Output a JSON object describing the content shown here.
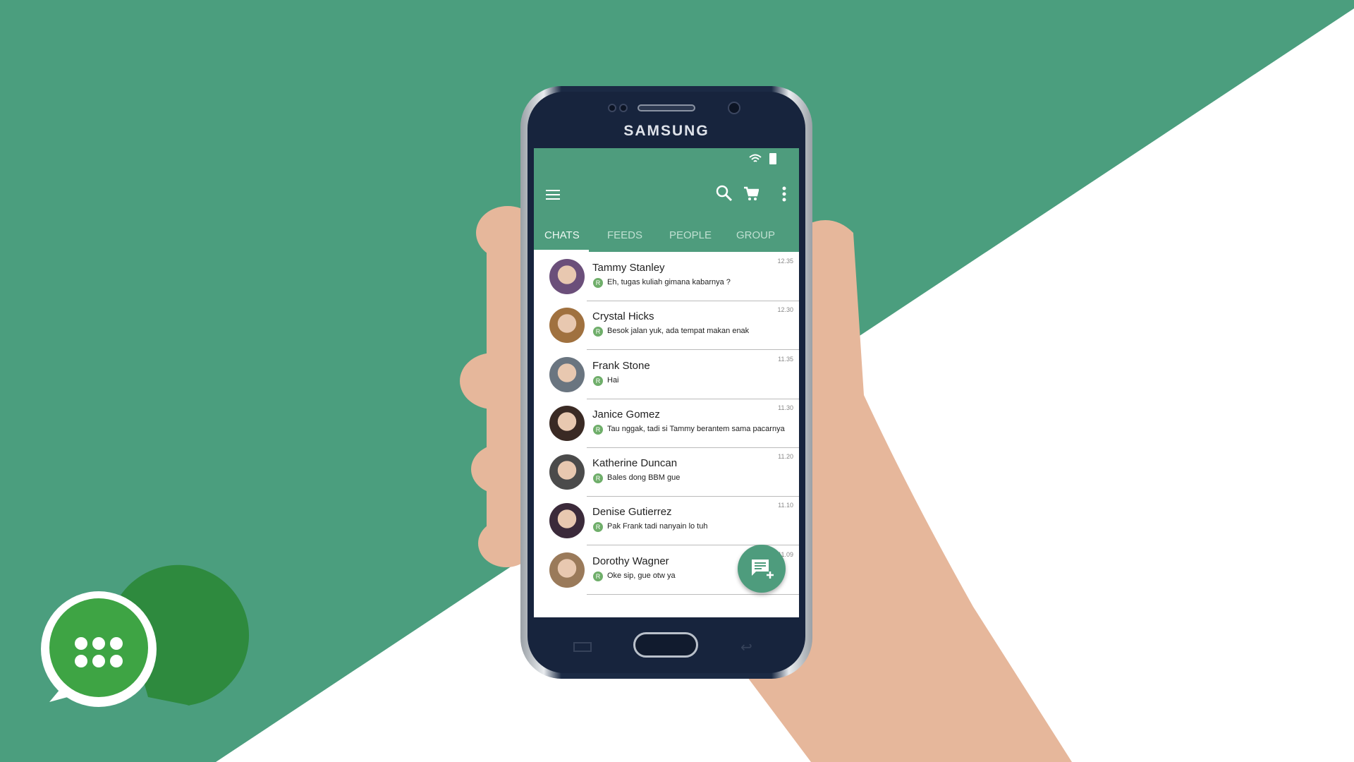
{
  "colors": {
    "background": "#4b9e7e",
    "accent": "#4e9c7d",
    "receipt": "#6fae6a"
  },
  "device": {
    "brand": "SAMSUNG"
  },
  "toolbar": {
    "menu_icon": "hamburger-icon",
    "actions": [
      "search-icon",
      "cart-icon",
      "more-vert-icon"
    ]
  },
  "tabs": [
    {
      "label": "CHATS",
      "active": true
    },
    {
      "label": "FEEDS"
    },
    {
      "label": "PEOPLE"
    },
    {
      "label": "GROUP"
    }
  ],
  "chats": [
    {
      "name": "Tammy Stanley",
      "message": "Eh, tugas kuliah gimana kabarnya ?",
      "time": "12.35",
      "badge": "R"
    },
    {
      "name": "Crystal Hicks",
      "message": "Besok jalan yuk, ada tempat makan enak",
      "time": "12.30",
      "badge": "R"
    },
    {
      "name": "Frank Stone",
      "message": "Hai",
      "time": "11.35",
      "badge": "R"
    },
    {
      "name": "Janice Gomez",
      "message": "Tau nggak, tadi si Tammy berantem sama pacarnya",
      "time": "11.30",
      "badge": "R"
    },
    {
      "name": "Katherine Duncan",
      "message": "Bales dong BBM gue",
      "time": "11.20",
      "badge": "R"
    },
    {
      "name": "Denise Gutierrez",
      "message": "Pak Frank tadi nanyain lo tuh",
      "time": "11.10",
      "badge": "R"
    },
    {
      "name": "Dorothy Wagner",
      "message": "Oke sip, gue otw ya",
      "time": "11.09",
      "badge": "R"
    }
  ],
  "fab": {
    "icon": "new-chat-icon"
  }
}
